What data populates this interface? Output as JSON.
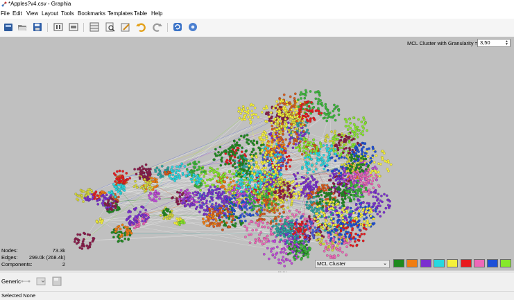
{
  "window": {
    "title": "*Apples?v4.csv - Graphia"
  },
  "menus": [
    {
      "label": "File"
    },
    {
      "label": "Edit"
    },
    {
      "label": "View"
    },
    {
      "label": "Layout"
    },
    {
      "label": "Tools"
    },
    {
      "label": "Bookmarks"
    },
    {
      "label": "Templates"
    },
    {
      "label": "Table"
    },
    {
      "label": "Help"
    }
  ],
  "toolbar": {
    "icons": [
      "open-file-icon",
      "open-folder-icon",
      "save-icon",
      "pause-layout-icon",
      "overview-icon",
      "table-icon",
      "find-icon",
      "edit-icon",
      "undo-icon",
      "redo-icon",
      "refresh-icon",
      "settings-icon"
    ]
  },
  "transform": {
    "label": "MCL Cluster with Granularity =",
    "value": "3,50"
  },
  "stats": {
    "nodes_label": "Nodes:",
    "nodes_value": "73.3k",
    "edges_label": "Edges:",
    "edges_value": "299.0k (268.4k)",
    "components_label": "Components:",
    "components_value": "2"
  },
  "visualisation": {
    "attribute_select": "MCL Cluster",
    "swatches": [
      "#1f8a1f",
      "#f07d12",
      "#7b2fd0",
      "#26d8e0",
      "#f5f03a",
      "#e8191d",
      "#ee68b8",
      "#1d4fd8",
      "#86e82a"
    ]
  },
  "bottom_panel": {
    "label": "Generic"
  },
  "status": {
    "text": "Selected None"
  }
}
